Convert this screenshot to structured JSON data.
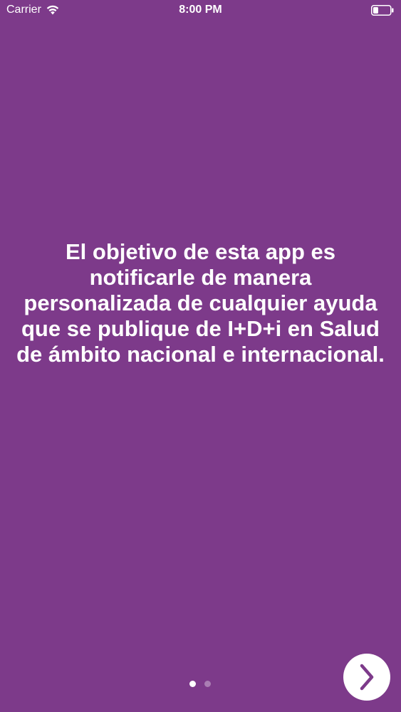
{
  "status_bar": {
    "carrier": "Carrier",
    "time": "8:00 PM",
    "icons": [
      "wifi-icon",
      "battery-icon"
    ]
  },
  "onboarding": {
    "message": "El objetivo de esta app es notificarle de manera personalizada de cualquier ayuda que se publique de I+D+i en Salud de ámbito nacional e internacional.",
    "page_indicator": {
      "current": 1,
      "total": 2
    },
    "next_button_icon": "chevron-right-icon"
  },
  "colors": {
    "background": "#7d3a8a",
    "text": "#ffffff",
    "button_bg": "#ffffff",
    "button_icon": "#7d3a8a"
  }
}
